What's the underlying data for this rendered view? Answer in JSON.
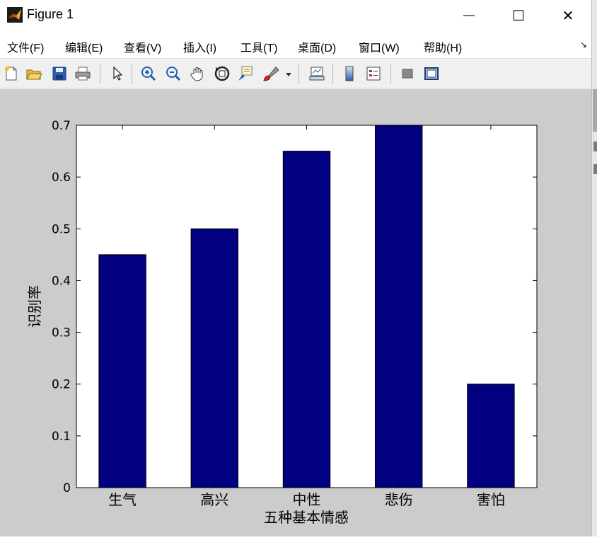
{
  "window": {
    "title": "Figure 1",
    "minimize_glyph": "—",
    "maximize_glyph": "☐",
    "close_glyph": "✕"
  },
  "menu": [
    "文件(F)",
    "编辑(E)",
    "查看(V)",
    "插入(I)",
    "工具(T)",
    "桌面(D)",
    "窗口(W)",
    "帮助(H)"
  ],
  "menu_arrow": "↘",
  "toolbar": {
    "icons": [
      "new-figure-icon",
      "open-file-icon",
      "save-icon",
      "print-icon",
      "pointer-icon",
      "zoom-in-icon",
      "zoom-out-icon",
      "pan-icon",
      "rotate-3d-icon",
      "data-cursor-icon",
      "brush-icon",
      "brush-dropdown-icon",
      "link-plot-icon",
      "colorbar-icon",
      "legend-icon",
      "hide-plot-tools-icon",
      "show-plot-tools-icon"
    ]
  },
  "colors": {
    "bar": "#000080",
    "figure_bg": "#cccccc",
    "axes_bg": "#ffffff"
  },
  "chart_data": {
    "type": "bar",
    "categories": [
      "生气",
      "高兴",
      "中性",
      "悲伤",
      "害怕"
    ],
    "values": [
      0.45,
      0.5,
      0.65,
      0.7,
      0.2
    ],
    "title": "",
    "xlabel": "五种基本情感",
    "ylabel": "识别率",
    "ylim": [
      0,
      0.7
    ],
    "yticks": [
      "0",
      "0.1",
      "0.2",
      "0.3",
      "0.4",
      "0.5",
      "0.6",
      "0.7"
    ],
    "grid": false
  }
}
